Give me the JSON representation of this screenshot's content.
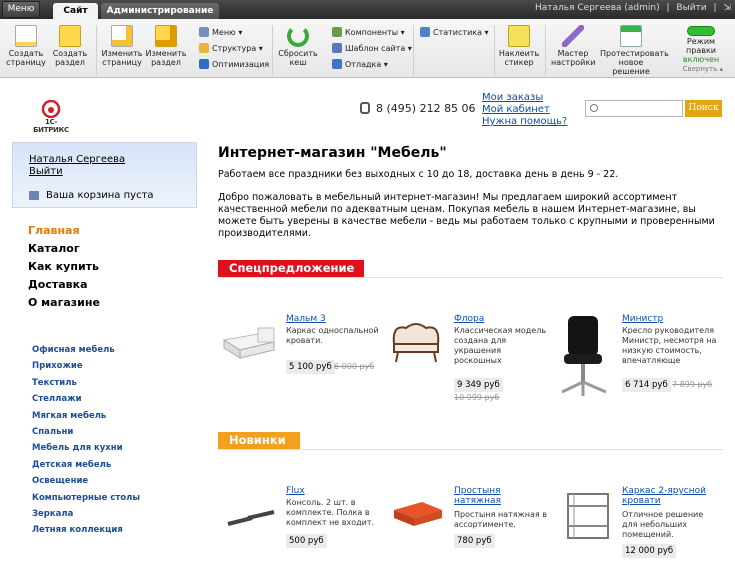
{
  "admin_panel": {
    "menu_label": "Меню",
    "tabs": [
      {
        "label": "Сайт",
        "active": true
      },
      {
        "label": "Администрирование",
        "active": false
      }
    ],
    "user": "Наталья Сергеева (admin)",
    "logout": "Выйти",
    "toolbar": {
      "create_page": "Создать страницу",
      "create_section": "Создать раздел",
      "edit_page": "Изменить страницу",
      "edit_section": "Изменить раздел",
      "menu": "Меню",
      "structure": "Структура",
      "seo": "Оптимизация",
      "reset_cache": "Сбросить кеш",
      "components": "Компоненты",
      "site_template": "Шаблон сайта",
      "debug": "Отладка",
      "statistics": "Статистика",
      "sticker": "Наклеить стикер",
      "wizard": "Мастер настройки",
      "test_solution": "Протестировать новое решение",
      "edit_mode_label": "Режим правки",
      "edit_mode_state": "включен",
      "collapse": "Свернуть"
    }
  },
  "header": {
    "logo_text": "1С-БИТРИКС",
    "phone": "8 (495) 212 85 06",
    "links": [
      "Мои заказы",
      "Мой кабинет",
      "Нужна помощь?"
    ],
    "search_placeholder": "",
    "search_button": "Поиск"
  },
  "sidebar": {
    "user_name": "Наталья Сергеева",
    "logout": "Выйти",
    "cart": "Ваша корзина пуста",
    "main_nav": [
      "Главная",
      "Каталог",
      "Как купить",
      "Доставка",
      "О магазине"
    ],
    "categories": [
      "Офисная мебель",
      "Прихожие",
      "Текстиль",
      "Стеллажи",
      "Мягкая мебель",
      "Спальни",
      "Мебель для кухни",
      "Детская мебель",
      "Освещение",
      "Компьютерные столы",
      "Зеркала",
      "Летняя коллекция"
    ]
  },
  "main": {
    "title": "Интернет-магазин \"Мебель\"",
    "notice": "Работаем все праздники без выходных с 10 до 18, доставка день в день 9 - 22.",
    "welcome": "Добро пожаловать в мебельный интернет-магазин! Мы предлагаем широкий ассортимент качественной мебели по адекватным ценам. Покупая мебель в нашем Интернет-магазине, вы можете быть уверены в качестве мебели - ведь мы работаем только с крупными и проверенными производителями.",
    "special_title": "Спецпредложение",
    "special": [
      {
        "name": "Мальм 3",
        "desc": "Каркас односпальной кровати.",
        "price": "5 100 руб",
        "old": "6 000 руб"
      },
      {
        "name": "Флора",
        "desc": "Классическая модель создана для украшения роскошных интерьеров.",
        "price": "9 349 руб",
        "old": "10 999 руб"
      },
      {
        "name": "Министр",
        "desc": "Кресло руководителя Министр, несмотря на низкую стоимость, впечатляюще выглядит.",
        "price": "6 714 руб",
        "old": "7 899 руб"
      }
    ],
    "new_title": "Новинки",
    "new": [
      {
        "name": "Flux",
        "desc": "Консоль. 2 шт. в комплекте. Полка в комплект не входит.",
        "price": "500 руб"
      },
      {
        "name": "Простыня натяжная",
        "desc": "Простыня натяжная в ассортименте.",
        "price": "780 руб"
      },
      {
        "name": "Каркас 2-ярусной кровати",
        "desc": "Отличное решение для небольших помещений.",
        "price": "12 000 руб"
      }
    ]
  }
}
